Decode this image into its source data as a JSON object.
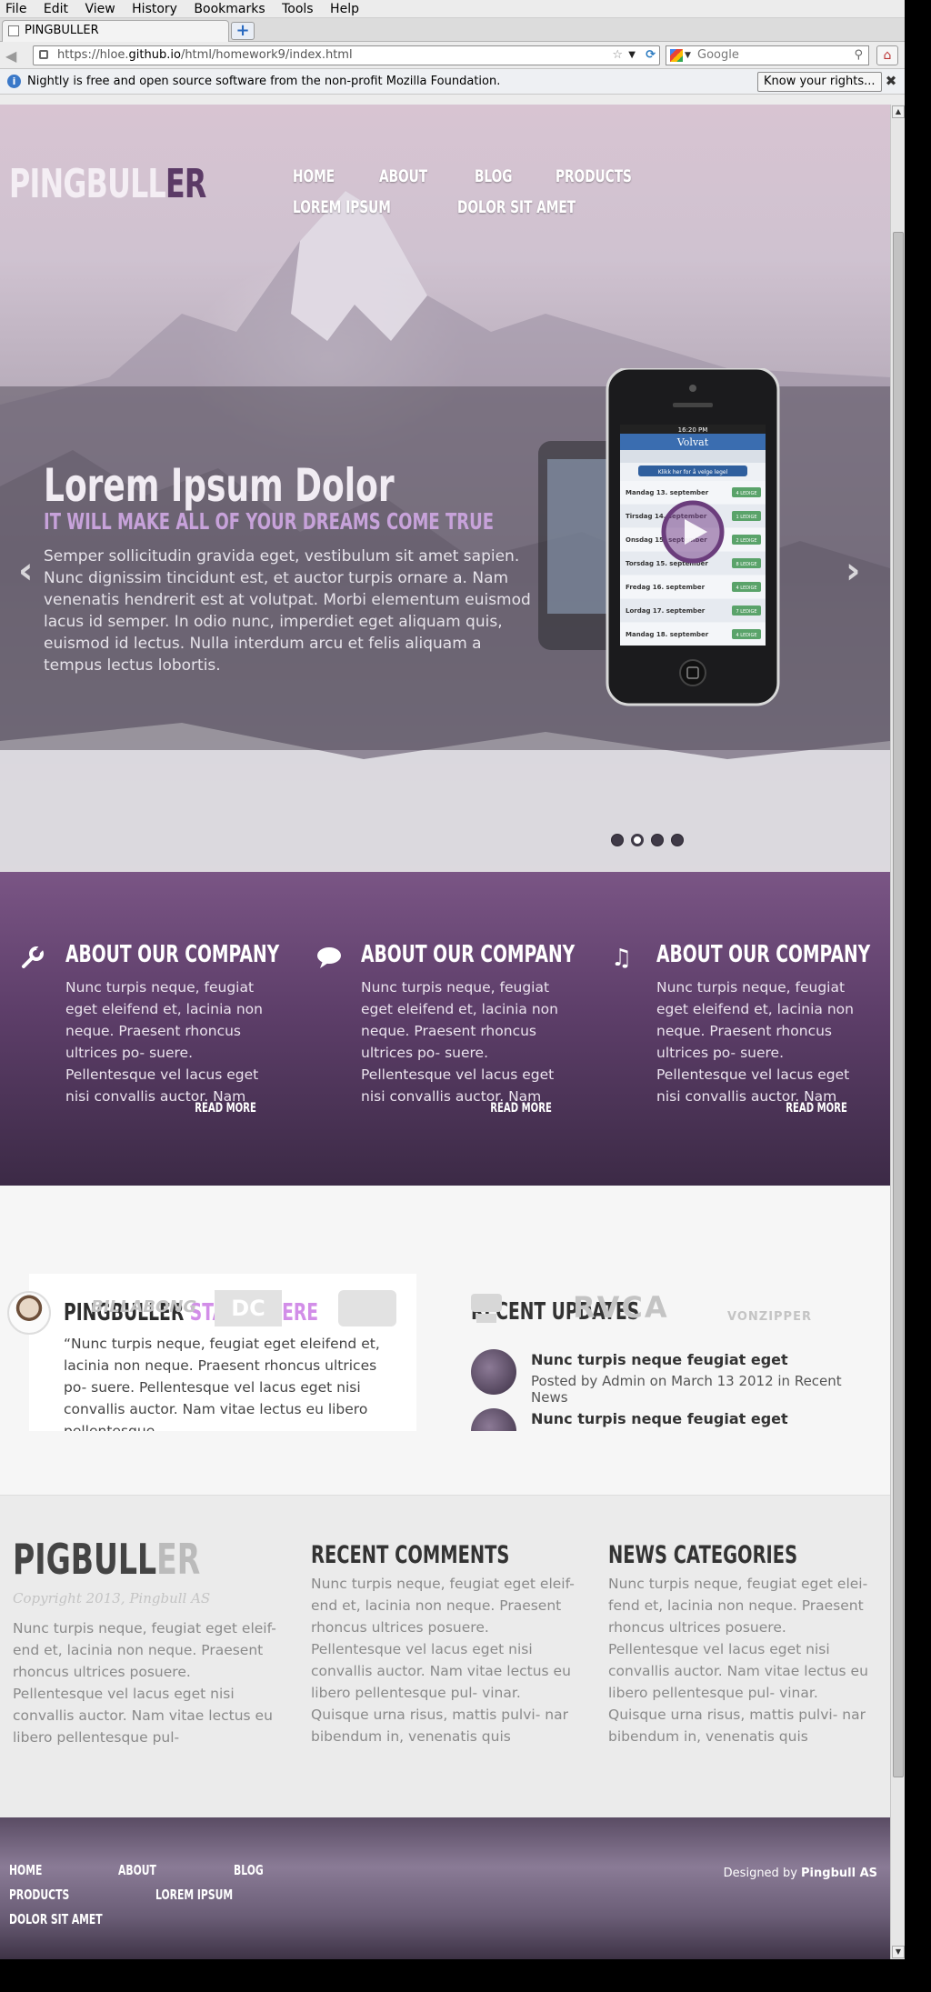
{
  "browser": {
    "menu": [
      "File",
      "Edit",
      "View",
      "History",
      "Bookmarks",
      "Tools",
      "Help"
    ],
    "tab_title": "PINGBULLER",
    "url_prefix": "https://hloe.",
    "url_host": "github.io",
    "url_path": "/html/homework9/index.html",
    "search_placeholder": "Google",
    "notification": "Nightly is free and open source software from the non-profit Mozilla Foundation.",
    "rights_button": "Know your rights..."
  },
  "header": {
    "logo_main": "PINGBULL",
    "logo_accent": "ER",
    "nav": [
      "HOME",
      "ABOUT",
      "BLOG",
      "PRODUCTS",
      "LOREM IPSUM",
      "DOLOR SIT AMET"
    ]
  },
  "slider": {
    "title": "Lorem Ipsum Dolor",
    "subtitle": "IT WILL MAKE ALL OF YOUR DREAMS COME TRUE",
    "text": "Semper sollicitudin gravida eget, vestibulum sit amet sapien. Nunc dignissim tincidunt est, et auctor turpis ornare a. Nam venenatis hendrerit est at volutpat. Morbi elementum euismod lacus id semper. In odio nunc, imperdiet eget aliquam quis, euismod id lectus. Nulla interdum arcu et felis aliquam a tempus lectus lobortis.",
    "prev": "‹",
    "next": "›",
    "active_dot": 2,
    "dot_count": 4,
    "phone": {
      "time": "16:20 PM",
      "logo": "Volvat",
      "cta": "Klikk her for å velge legel",
      "rows": [
        {
          "day": "Mandag 13. september",
          "tag": "4 LEDIGE"
        },
        {
          "day": "Tirsdag 14. september",
          "tag": "1 LEDIGE"
        },
        {
          "day": "Onsdag 15. september",
          "tag": "2 LEDIGE"
        },
        {
          "day": "Torsdag 15. september",
          "tag": "8 LEDIGE"
        },
        {
          "day": "Fredag 16. september",
          "tag": "4 LEDIGE"
        },
        {
          "day": "Lordag 17. september",
          "tag": "7 LEDIGE"
        },
        {
          "day": "Mandag 18. september",
          "tag": "4 LEDIGE"
        }
      ]
    }
  },
  "features": [
    {
      "icon": "wrench-icon",
      "title": "ABOUT OUR COMPANY",
      "text": "Nunc turpis neque, feugiat eget eleifend et, lacinia non neque. Praesent rhoncus ultrices po- suere. Pellentesque vel lacus eget nisi convallis auctor. Nam",
      "link": "READ MORE"
    },
    {
      "icon": "speech-bubble-icon",
      "title": "ABOUT OUR COMPANY",
      "text": "Nunc turpis neque, feugiat eget eleifend et, lacinia non neque. Praesent rhoncus ultrices po- suere. Pellentesque vel lacus eget nisi convallis auctor. Nam",
      "link": "READ MORE"
    },
    {
      "icon": "music-note-icon",
      "title": "ABOUT OUR COMPANY",
      "text": "Nunc turpis neque, feugiat eget eleifend et, lacinia non neque. Praesent rhoncus ultrices po- suere. Pellentesque vel lacus eget nisi convallis auctor. Nam",
      "link": "READ MORE"
    }
  ],
  "intro": {
    "title_main": "PINGBULLER",
    "title_accent": "STARTS HERE",
    "text": "“Nunc turpis neque, feugiat eget eleifend et, lacinia non neque. Praesent rhoncus ultrices po- suere. Pellentesque vel lacus eget nisi convallis auctor. Nam vitae lectus eu libero pellentesque"
  },
  "updates": {
    "title": "RECENT UPDATES",
    "items": [
      {
        "title": "Nunc turpis neque feugiat eget",
        "meta": "Posted by Admin on March 13 2012 in Recent News"
      },
      {
        "title": "Nunc turpis neque feugiat eget",
        "meta": ""
      }
    ]
  },
  "brands": [
    "BILLABONG",
    "DC",
    "",
    "",
    "RVCA",
    "VONZIPPER"
  ],
  "footer": {
    "logo_main": "PIGBULL",
    "logo_light": "ER",
    "copyright": "Copyright 2013, Pingbull AS",
    "about_text": "Nunc turpis neque, feugiat eget eleif- end et, lacinia non neque. Praesent rhoncus ultrices posuere. Pellentesque vel lacus eget nisi convallis auctor. Nam vitae lectus eu libero pellentesque pul-",
    "comments_title": "RECENT COMMENTS",
    "comments_text": "Nunc turpis neque, feugiat eget eleif- end et, lacinia non neque. Praesent rhoncus ultrices posuere. Pellentesque vel lacus eget nisi convallis auctor. Nam vitae lectus eu libero pellentesque pul- vinar. Quisque urna risus, mattis pulvi- nar bibendum in, venenatis quis",
    "categories_title": "NEWS CATEGORIES",
    "categories_text": "Nunc turpis neque, feugiat eget elei- fend et, lacinia non neque. Praesent rhoncus ultrices posuere. Pellentesque vel lacus eget nisi convallis auctor. Nam vitae lectus eu libero pellentesque pul- vinar. Quisque urna risus, mattis pulvi- nar bibendum in, venenatis quis",
    "nav": [
      "HOME",
      "ABOUT",
      "BLOG",
      "PRODUCTS",
      "LOREM IPSUM",
      "DOLOR SIT AMET"
    ],
    "designed_prefix": "Designed by",
    "designed_by": "Pingbull AS"
  },
  "colors": {
    "accent_purple": "#5d3e69",
    "accent_pink": "#d28ee8",
    "subtitle_lilac": "#c7a2da"
  }
}
